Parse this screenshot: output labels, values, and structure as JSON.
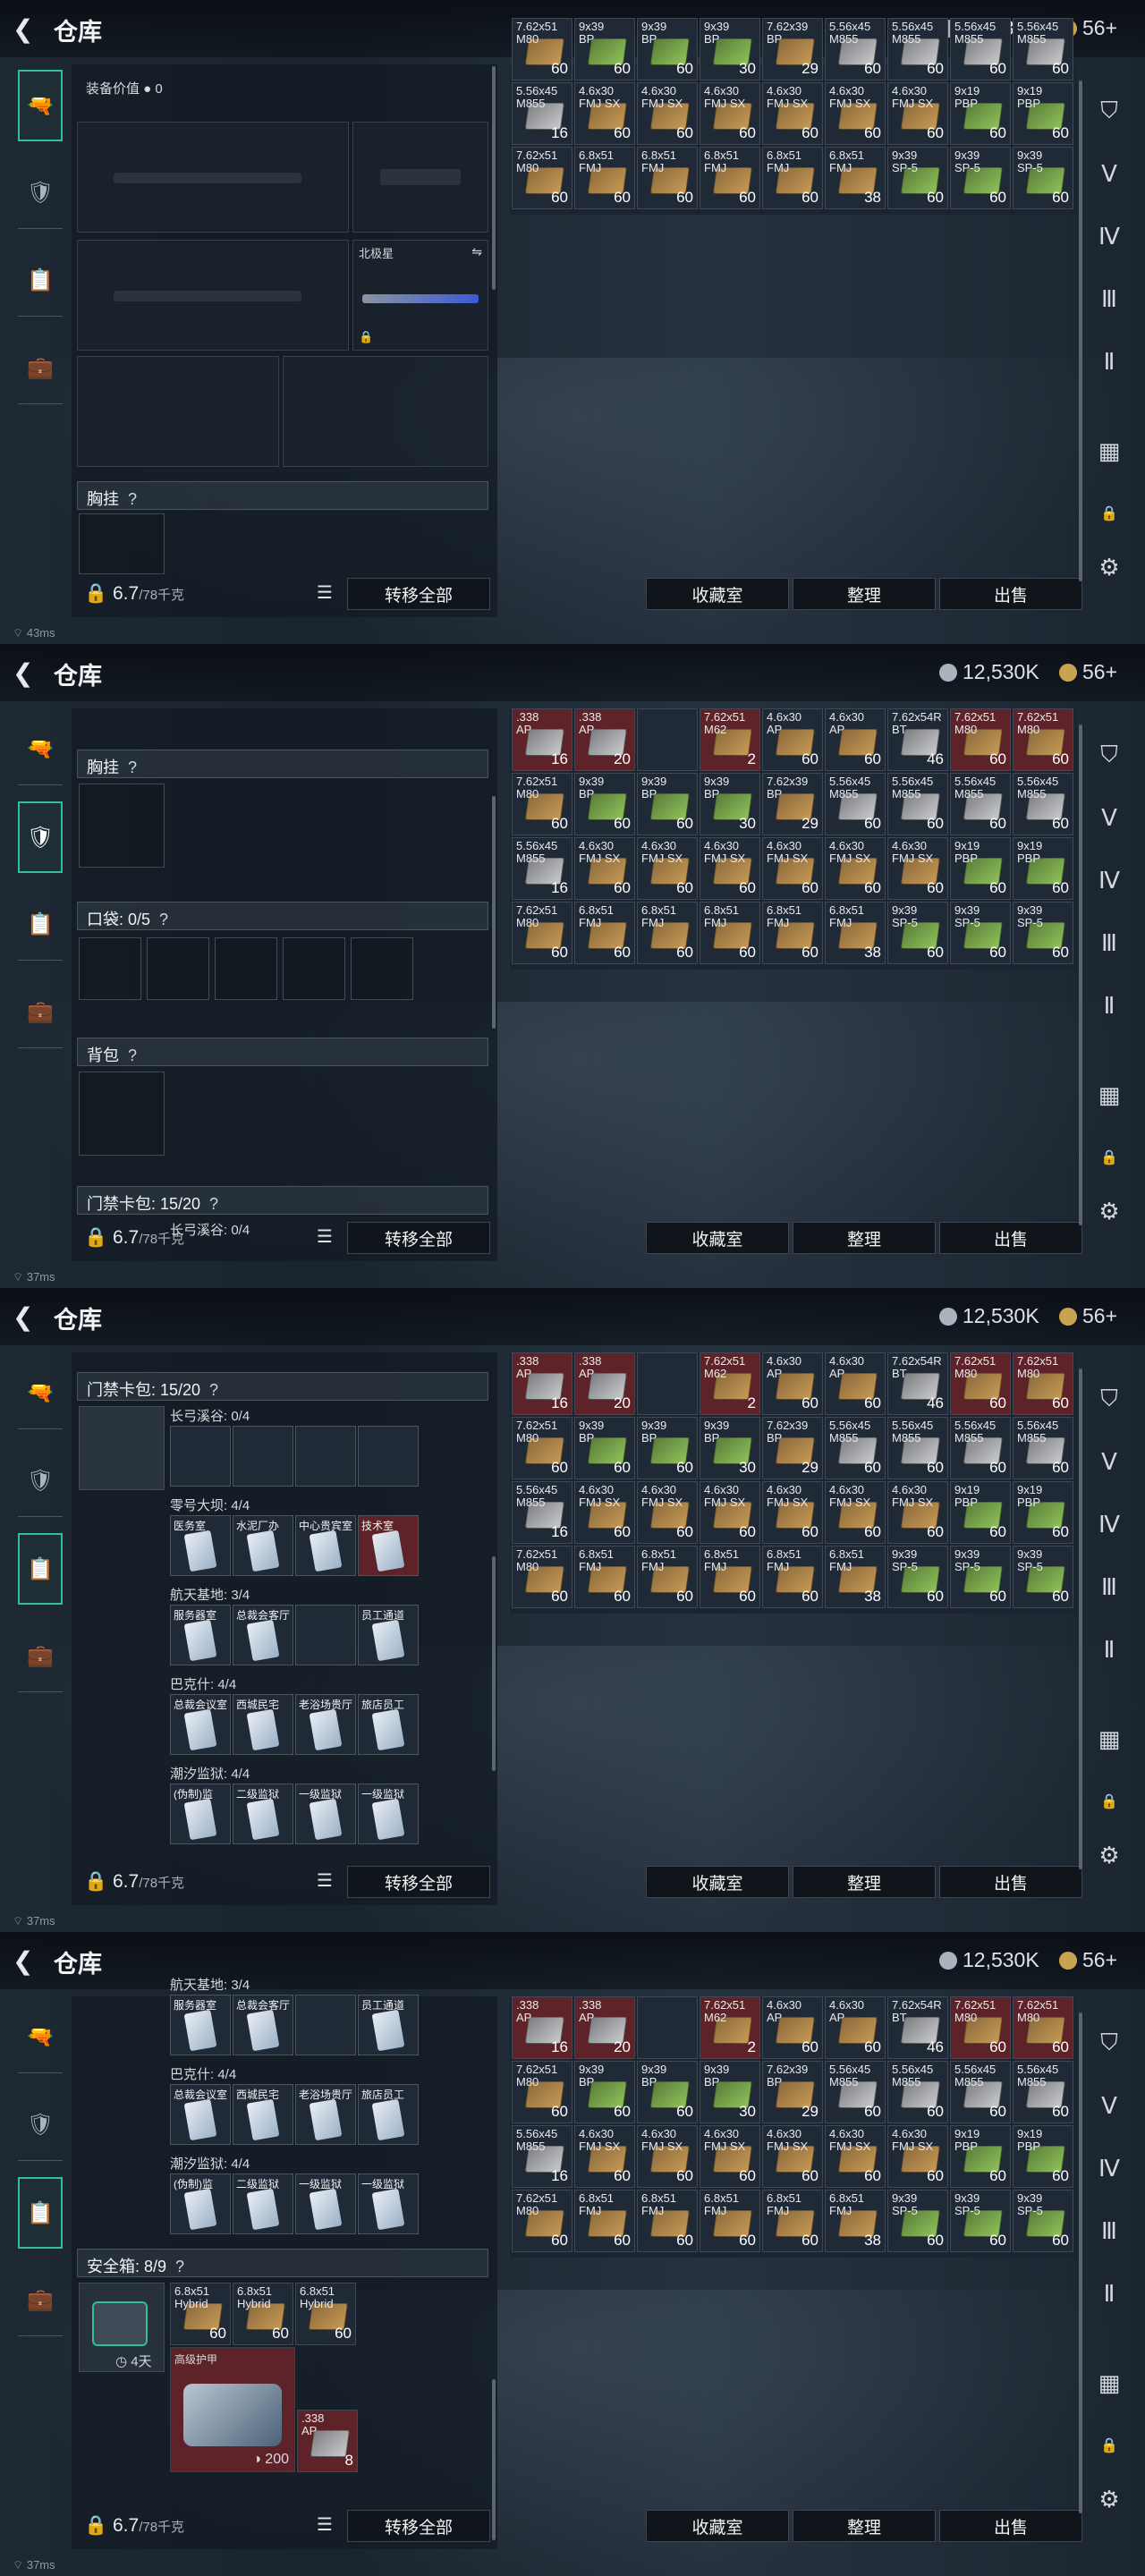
{
  "header": {
    "title": "仓库",
    "back_icon": "back-arrow-icon",
    "currency_silver": "12,530K",
    "currency_gold": "56+"
  },
  "colors": {
    "accent": "#2fbf9a",
    "red_cell": "#5e2328"
  },
  "sidebar": {
    "items": [
      "weapon-tab",
      "armor-tab",
      "card-tab",
      "case-tab"
    ]
  },
  "footer": {
    "weight": "6.7",
    "weight_max": "/78千克",
    "transfer_all": "转移全部",
    "collection": "收藏室",
    "organize": "整理",
    "sell": "出售"
  },
  "status": {
    "ping": [
      "43ms",
      "37ms",
      "37ms",
      "37ms"
    ]
  },
  "screen1": {
    "equip_value_label": "装备价值",
    "equip_value": "0",
    "knife_label": "北极星",
    "chest_rig": "胸挂"
  },
  "screen2": {
    "chest_rig": "胸挂",
    "pockets": "口袋: 0/5",
    "backpack": "背包",
    "keycard": "门禁卡包: 15/20",
    "keycard_sub": "长弓溪谷: 0/4"
  },
  "screen3": {
    "keycard": "门禁卡包: 15/20",
    "groups": [
      {
        "label": "长弓溪谷: 0/4",
        "cards": [
          "",
          "",
          "",
          ""
        ]
      },
      {
        "label": "零号大坝: 4/4",
        "cards": [
          "医务室",
          "水泥厂办",
          "中心贵宾室",
          "技术室"
        ]
      },
      {
        "label": "航天基地: 3/4",
        "cards": [
          "服务器室",
          "总裁会客厅",
          "",
          "员工通道"
        ]
      },
      {
        "label": "巴克什: 4/4",
        "cards": [
          "总裁会议室",
          "西城民宅",
          "老浴场贵厅",
          "旅店员工"
        ]
      },
      {
        "label": "潮汐监狱: 4/4",
        "cards": [
          "(伪制)监",
          "二级监狱",
          "一级监狱",
          "一级监狱"
        ]
      }
    ]
  },
  "screen4": {
    "groups": [
      {
        "label": "航天基地: 3/4",
        "cards": [
          "服务器室",
          "总裁会客厅",
          "",
          "员工通道"
        ]
      },
      {
        "label": "巴克什: 4/4",
        "cards": [
          "总裁会议室",
          "西城民宅",
          "老浴场贵厅",
          "旅店员工"
        ]
      },
      {
        "label": "潮汐监狱: 4/4",
        "cards": [
          "(伪制)监",
          "二级监狱",
          "一级监狱",
          "一级监狱"
        ]
      }
    ],
    "safebox": "安全箱: 8/9",
    "safebox_days": "4天",
    "safe_items": [
      {
        "name": "6.8x51\nHybrid",
        "qty": "60"
      },
      {
        "name": "6.8x51\nHybrid",
        "qty": "60"
      },
      {
        "name": "6.8x51\nHybrid",
        "qty": "60"
      }
    ],
    "armor_label": "高级护甲",
    "armor_qty": "200",
    "small_item": {
      "name": ".338\nAP",
      "qty": "8"
    }
  },
  "grid": {
    "rows": [
      [
        {
          "n": ".338\nAP",
          "q": "16",
          "c": "red",
          "a": "ammo-s"
        },
        {
          "n": ".338\nAP",
          "q": "20",
          "c": "red",
          "a": "ammo-s"
        },
        {
          "n": "",
          "q": "",
          "c": "dark",
          "a": ""
        },
        {
          "n": "7.62x51\nM62",
          "q": "2",
          "c": "red",
          "a": "ammo-g"
        },
        {
          "n": "4.6x30\nAP",
          "q": "60",
          "c": "dark",
          "a": "ammo-g"
        },
        {
          "n": "4.6x30\nAP",
          "q": "60",
          "c": "dark",
          "a": "ammo-g"
        },
        {
          "n": "7.62x54R\nBT",
          "q": "46",
          "c": "dark",
          "a": "ammo-s"
        },
        {
          "n": "7.62x51\nM80",
          "q": "60",
          "c": "red",
          "a": "ammo-g"
        },
        {
          "n": "7.62x51\nM80",
          "q": "60",
          "c": "red",
          "a": "ammo-g"
        }
      ],
      [
        {
          "n": "7.62x51\nM80",
          "q": "60",
          "c": "dark",
          "a": "ammo-g"
        },
        {
          "n": "9x39\nBP",
          "q": "60",
          "c": "dark",
          "a": "ammo-gn"
        },
        {
          "n": "9x39\nBP",
          "q": "60",
          "c": "dark",
          "a": "ammo-gn"
        },
        {
          "n": "9x39\nBP",
          "q": "30",
          "c": "dark",
          "a": "ammo-gn"
        },
        {
          "n": "7.62x39\nBP",
          "q": "29",
          "c": "dark",
          "a": "ammo-g"
        },
        {
          "n": "5.56x45\nM855",
          "q": "60",
          "c": "dark",
          "a": "ammo-s"
        },
        {
          "n": "5.56x45\nM855",
          "q": "60",
          "c": "dark",
          "a": "ammo-s"
        },
        {
          "n": "5.56x45\nM855",
          "q": "60",
          "c": "dark",
          "a": "ammo-s"
        },
        {
          "n": "5.56x45\nM855",
          "q": "60",
          "c": "dark",
          "a": "ammo-s"
        }
      ],
      [
        {
          "n": "5.56x45\nM855",
          "q": "16",
          "c": "dark",
          "a": "ammo-s"
        },
        {
          "n": "4.6x30\nFMJ SX",
          "q": "60",
          "c": "dark",
          "a": "ammo-g"
        },
        {
          "n": "4.6x30\nFMJ SX",
          "q": "60",
          "c": "dark",
          "a": "ammo-g"
        },
        {
          "n": "4.6x30\nFMJ SX",
          "q": "60",
          "c": "dark",
          "a": "ammo-g"
        },
        {
          "n": "4.6x30\nFMJ SX",
          "q": "60",
          "c": "dark",
          "a": "ammo-g"
        },
        {
          "n": "4.6x30\nFMJ SX",
          "q": "60",
          "c": "dark",
          "a": "ammo-g"
        },
        {
          "n": "4.6x30\nFMJ SX",
          "q": "60",
          "c": "dark",
          "a": "ammo-g"
        },
        {
          "n": "9x19\nPBP",
          "q": "60",
          "c": "dark",
          "a": "ammo-gn"
        },
        {
          "n": "9x19\nPBP",
          "q": "60",
          "c": "dark",
          "a": "ammo-gn"
        }
      ],
      [
        {
          "n": "7.62x51\nM80",
          "q": "60",
          "c": "dark",
          "a": "ammo-g"
        },
        {
          "n": "6.8x51\nFMJ",
          "q": "60",
          "c": "dark",
          "a": "ammo-g"
        },
        {
          "n": "6.8x51\nFMJ",
          "q": "60",
          "c": "dark",
          "a": "ammo-g"
        },
        {
          "n": "6.8x51\nFMJ",
          "q": "60",
          "c": "dark",
          "a": "ammo-g"
        },
        {
          "n": "6.8x51\nFMJ",
          "q": "60",
          "c": "dark",
          "a": "ammo-g"
        },
        {
          "n": "6.8x51\nFMJ",
          "q": "38",
          "c": "dark",
          "a": "ammo-g"
        },
        {
          "n": "9x39\nSP-5",
          "q": "60",
          "c": "dark",
          "a": "ammo-gn"
        },
        {
          "n": "9x39\nSP-5",
          "q": "60",
          "c": "dark",
          "a": "ammo-gn"
        },
        {
          "n": "9x39\nSP-5",
          "q": "60",
          "c": "dark",
          "a": "ammo-gn"
        }
      ]
    ]
  }
}
